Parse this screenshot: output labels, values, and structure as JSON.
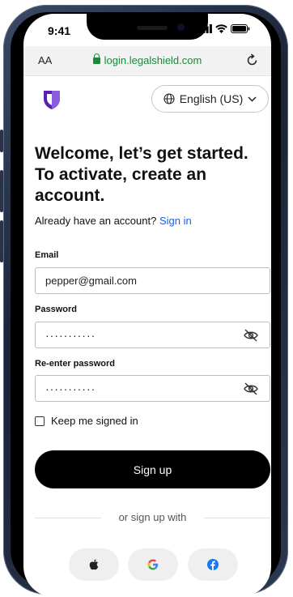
{
  "status_bar": {
    "time": "9:41"
  },
  "browser": {
    "text_size_label": "AA",
    "url": "login.legalshield.com"
  },
  "language": {
    "label": "English (US)"
  },
  "heading": {
    "title": "Welcome, let’s get started. To activate, create an account."
  },
  "signin_prompt": {
    "text": "Already have an account?",
    "link": "Sign in"
  },
  "form": {
    "email_label": "Email",
    "email_value": "pepper@gmail.com",
    "password_label": "Password",
    "password_value": "···········",
    "reenter_label": "Re-enter password",
    "reenter_value": "···········",
    "keep_signed_in": "Keep me signed in",
    "submit_label": "Sign up"
  },
  "social": {
    "divider_text": "or sign up with",
    "providers": [
      "apple-icon",
      "google-icon",
      "facebook-icon"
    ]
  },
  "colors": {
    "brand_purple": "#5b1fb8",
    "link_blue": "#1d5fd6",
    "url_green": "#1a8a3a"
  }
}
